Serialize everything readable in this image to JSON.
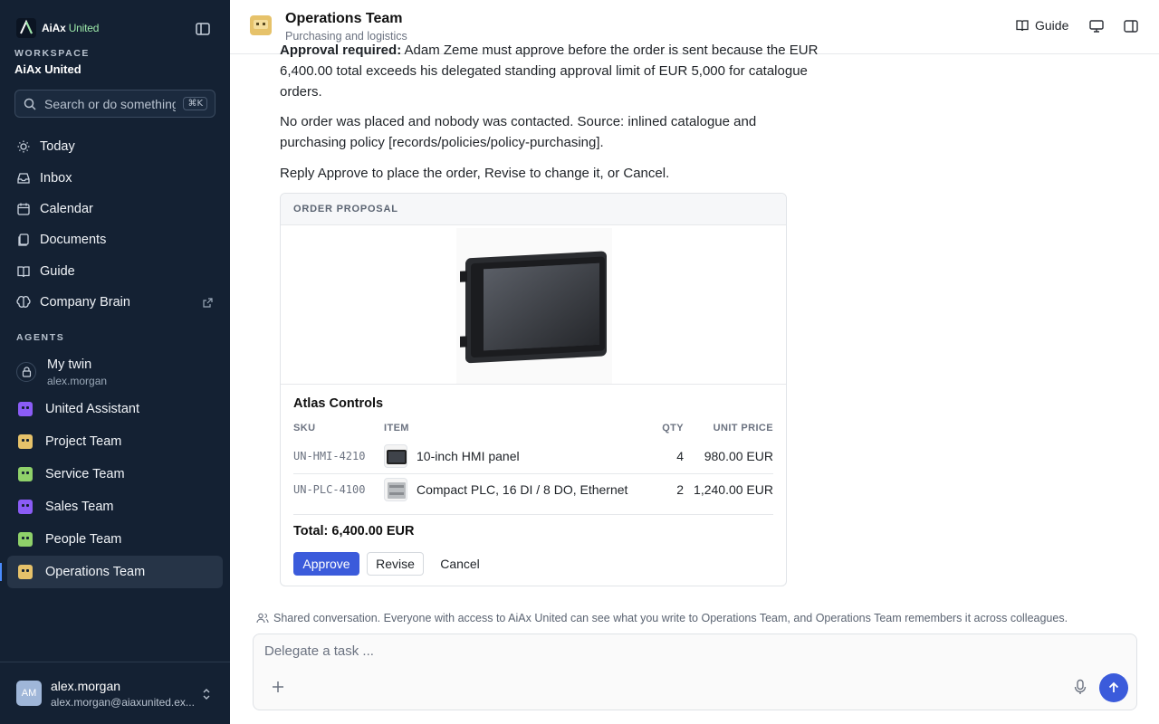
{
  "app": {
    "logo_prefix": "AiAx",
    "logo_suffix": "United"
  },
  "sidebar": {
    "workspace_label": "WORKSPACE",
    "workspace_name": "AiAx United",
    "search": {
      "placeholder": "Search or do something",
      "shortcut": "⌘K"
    },
    "nav": [
      {
        "label": "Today",
        "icon": "sun-icon"
      },
      {
        "label": "Inbox",
        "icon": "inbox-icon"
      },
      {
        "label": "Calendar",
        "icon": "calendar-icon"
      },
      {
        "label": "Documents",
        "icon": "documents-icon"
      },
      {
        "label": "Guide",
        "icon": "book-icon"
      },
      {
        "label": "Company Brain",
        "icon": "brain-icon"
      }
    ],
    "agents_label": "AGENTS",
    "twin": {
      "name": "My twin",
      "sub": "alex.morgan"
    },
    "agents": [
      {
        "label": "United Assistant",
        "color": "#8b5cf6"
      },
      {
        "label": "Project Team",
        "color": "#e6c26a"
      },
      {
        "label": "Service Team",
        "color": "#8fd16a"
      },
      {
        "label": "Sales Team",
        "color": "#8b5cf6"
      },
      {
        "label": "People Team",
        "color": "#8fd16a"
      },
      {
        "label": "Operations Team",
        "color": "#e6c26a"
      }
    ],
    "user": {
      "initials": "AM",
      "name": "alex.morgan",
      "email": "alex.morgan@aiaxunited.ex..."
    }
  },
  "header": {
    "title": "Operations Team",
    "subtitle": "Purchasing and logistics",
    "guide_label": "Guide"
  },
  "message": {
    "para1_bold": "Approval required:",
    "para1_rest": " Adam Zeme must approve before the order is sent because the EUR 6,400.00 total exceeds his delegated standing approval limit of EUR 5,000 for catalogue orders.",
    "para2": "No order was placed and nobody was contacted. Source: inlined catalogue and purchasing policy [records/policies/policy-purchasing].",
    "para3": "Reply Approve to place the order, Revise to change it, or Cancel."
  },
  "order": {
    "header": "ORDER PROPOSAL",
    "supplier": "Atlas Controls",
    "columns": {
      "sku": "SKU",
      "item": "ITEM",
      "qty": "QTY",
      "unit_price": "UNIT PRICE"
    },
    "rows": [
      {
        "sku": "UN-HMI-4210",
        "item": "10-inch HMI panel",
        "qty": "4",
        "unit_price": "980.00 EUR"
      },
      {
        "sku": "UN-PLC-4100",
        "item": "Compact PLC, 16 DI / 8 DO, Ethernet",
        "qty": "2",
        "unit_price": "1,240.00 EUR"
      }
    ],
    "total": "Total: 6,400.00 EUR",
    "buttons": {
      "approve": "Approve",
      "revise": "Revise",
      "cancel": "Cancel"
    }
  },
  "shared_note": "Shared conversation. Everyone with access to AiAx United can see what you write to Operations Team, and Operations Team remembers it across colleagues.",
  "composer": {
    "placeholder": "Delegate a task ..."
  }
}
